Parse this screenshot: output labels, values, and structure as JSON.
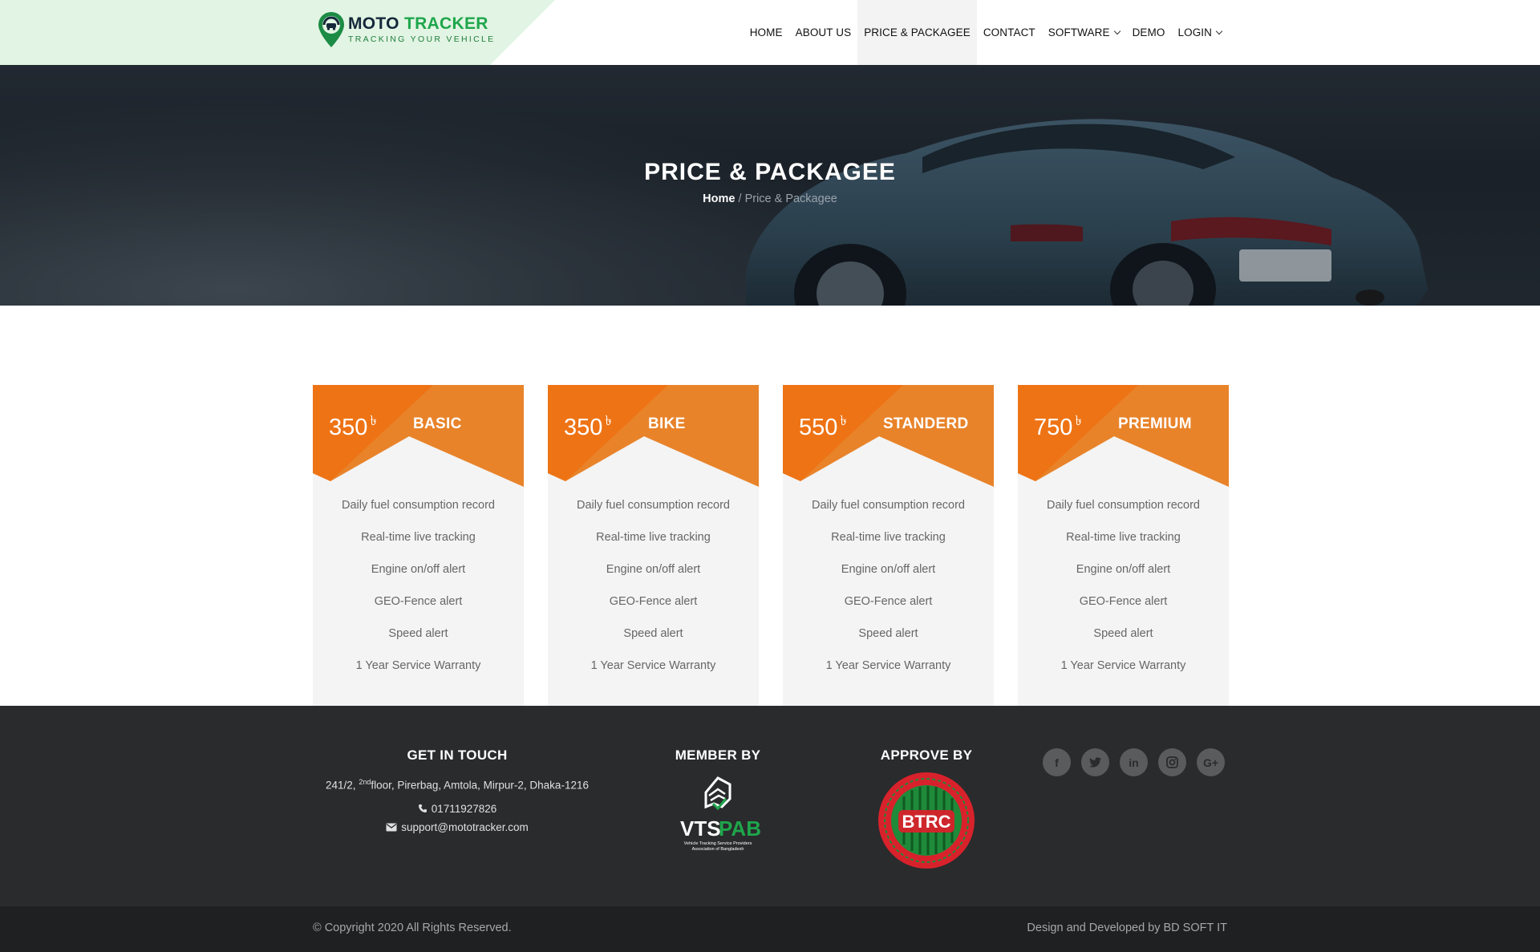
{
  "brand": {
    "name_part1": "MOTO",
    "name_part2": "TRACKER",
    "tagline": "TRACKING YOUR VEHICLE",
    "primary_color": "#1ea64b"
  },
  "nav": {
    "items": [
      {
        "label": "HOME",
        "active": false
      },
      {
        "label": "ABOUT US",
        "active": false
      },
      {
        "label": "PRICE & PACKAGEE",
        "active": true
      },
      {
        "label": "CONTACT",
        "active": false
      },
      {
        "label": "SOFTWARE",
        "active": false,
        "dropdown": true
      },
      {
        "label": "DEMO",
        "active": false
      },
      {
        "label": "LOGIN",
        "active": false,
        "dropdown": true
      }
    ]
  },
  "hero": {
    "title": "PRICE & PACKAGEE",
    "breadcrumb_home": "Home",
    "breadcrumb_sep": " / ",
    "breadcrumb_current": "Price & Packagee"
  },
  "pricing": {
    "accent_color": "#ee7314",
    "currency": "৳",
    "plans": [
      {
        "price": "350",
        "name": "BASIC"
      },
      {
        "price": "350",
        "name": "BIKE"
      },
      {
        "price": "550",
        "name": "STANDERD"
      },
      {
        "price": "750",
        "name": "PREMIUM"
      }
    ],
    "features": [
      "Daily fuel consumption record",
      "Real-time live tracking",
      "Engine on/off alert",
      "GEO-Fence alert",
      "Speed alert",
      "1 Year Service Warranty"
    ]
  },
  "footer": {
    "contact_heading": "GET IN TOUCH",
    "address_before": "241/2, ",
    "address_sup": "2nd",
    "address_after": "floor, Pirerbag, Amtola, Mirpur-2, Dhaka-1216",
    "phone": "01711927826",
    "email": "support@mototracker.com",
    "member_heading": "MEMBER BY",
    "member_logo_text_1": "VTS",
    "member_logo_text_2": "PAB",
    "member_logo_caption_1": "Vehicle Tracking Service Providers",
    "member_logo_caption_2": "Association of Bangladesh",
    "approve_heading": "APPROVE BY",
    "approve_logo_text": "BTRC",
    "social": [
      "facebook-icon",
      "twitter-icon",
      "linkedin-icon",
      "instagram-icon",
      "google-plus-icon"
    ],
    "copyright": "© Copyright 2020 All Rights Reserved.",
    "developer": "Design and Developed by BD SOFT IT"
  }
}
